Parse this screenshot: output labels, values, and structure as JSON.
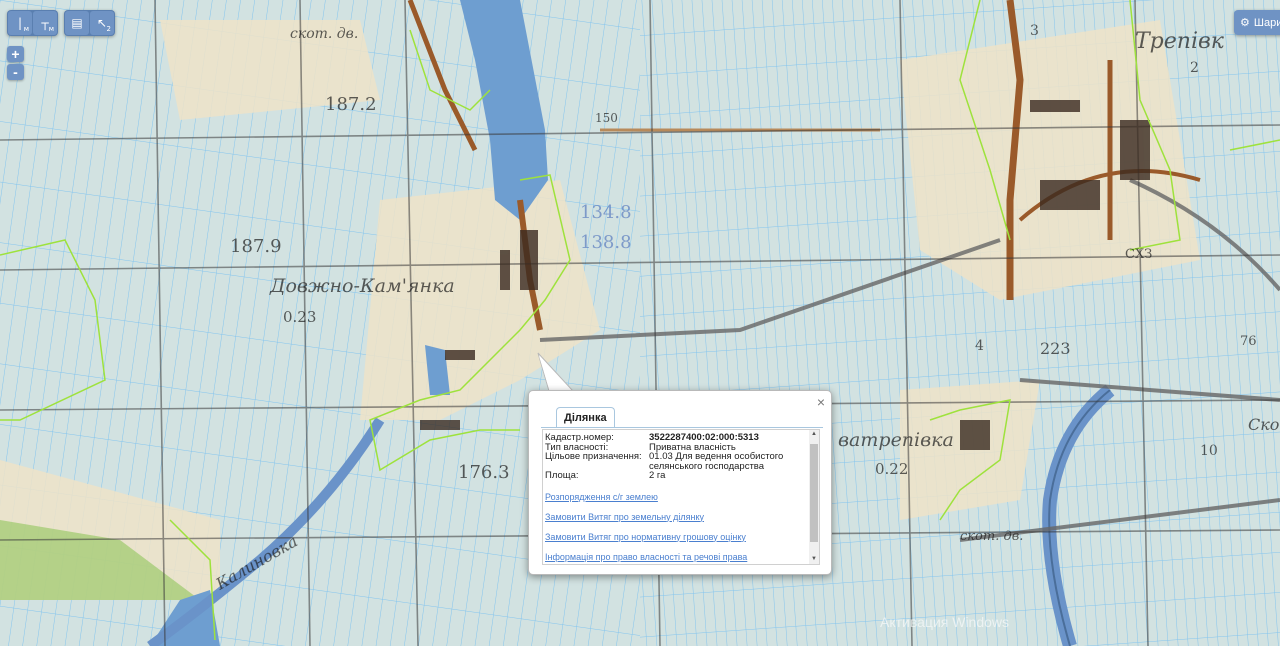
{
  "toolbar": {
    "measure_length_sub": "м",
    "measure_area_sub": "м",
    "select_sub": "2"
  },
  "zoom": {
    "in_label": "+",
    "out_label": "-"
  },
  "share": {
    "label": "Шари"
  },
  "map": {
    "place_labels": [
      "скот. дв.",
      "187.2",
      "187.9",
      "Довжно-Кам'янка",
      "0.23",
      "Трепівк",
      "150",
      "134.8",
      "138.8",
      "176.3",
      "Калиновка",
      "ватрепівка",
      "0.22",
      "скот. дв.",
      "223",
      "Скор",
      "10",
      "76",
      "СХЗ",
      "2",
      "3",
      "4"
    ],
    "colors": {
      "water": "#6e9ed0",
      "parcel_line": "#7fc3f0",
      "boundary": "#9ee23c",
      "grid": "#3a3a3a",
      "road": "#9a5a2a"
    }
  },
  "popup": {
    "close_label": "×",
    "tab_label": "Ділянка",
    "fields": [
      {
        "label": "Кадастр.номер:",
        "value": "3522287400:02:000:5313",
        "bold": true
      },
      {
        "label": "Тип власності:",
        "value": "Приватна власність"
      },
      {
        "label": "Цільове призначення:",
        "value": "01.03 Для ведення особистого селянського господарства"
      },
      {
        "label": "Площа:",
        "value": "2 га"
      }
    ],
    "links": [
      "Розпорядження с/г землею",
      "Замовити Витяг про земельну ділянку",
      "Замовити Витяг про нормативну грошову оцінку",
      "Інформація про право власності та речові права"
    ]
  },
  "watermark": "Активация Windows"
}
